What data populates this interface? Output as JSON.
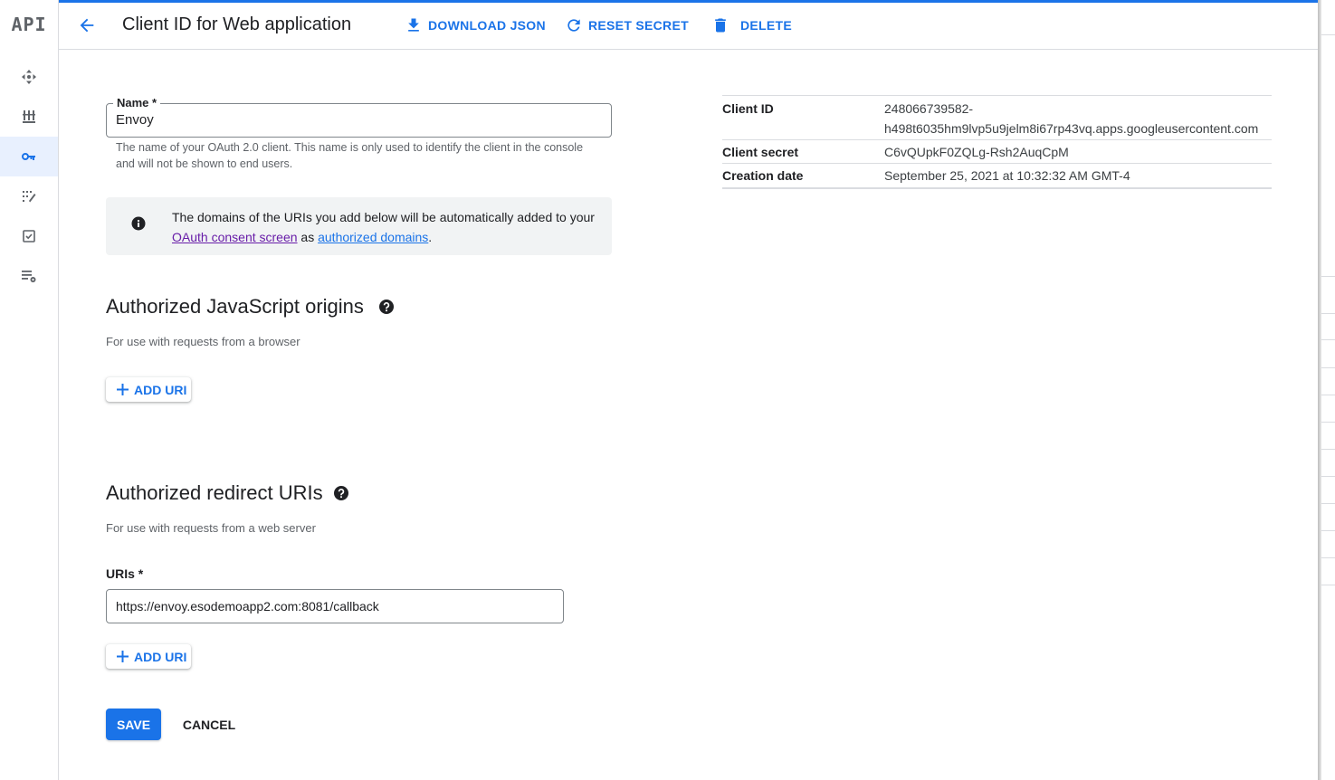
{
  "rail": {
    "logo": "API",
    "items": [
      {
        "icon": "dashboard-icon"
      },
      {
        "icon": "library-icon"
      },
      {
        "icon": "key-icon",
        "active": true
      },
      {
        "icon": "consent-icon"
      },
      {
        "icon": "checkbox-icon"
      },
      {
        "icon": "settings-list-icon"
      }
    ]
  },
  "header": {
    "title": "Client ID for Web application",
    "download_label": "DOWNLOAD JSON",
    "reset_label": "RESET SECRET",
    "delete_label": "DELETE"
  },
  "name_field": {
    "label": "Name *",
    "value": "Envoy",
    "hint": "The name of your OAuth 2.0 client. This name is only used to identify the client in the console and will not be shown to end users."
  },
  "info": {
    "text_before": "The domains of the URIs you add below will be automatically added to your ",
    "consent_link": "OAuth consent screen",
    "text_middle": " as ",
    "domains_link": "authorized domains",
    "text_after": "."
  },
  "js_origins": {
    "title": "Authorized JavaScript origins",
    "subtitle": "For use with requests from a browser",
    "add_label": "ADD URI"
  },
  "redirect_uris": {
    "title": "Authorized redirect URIs",
    "subtitle": "For use with requests from a web server",
    "uris_label": "URIs *",
    "uri_value": "https://envoy.esodemoapp2.com:8081/callback",
    "add_label": "ADD URI"
  },
  "actions": {
    "save_label": "SAVE",
    "cancel_label": "CANCEL"
  },
  "details": {
    "client_id_label": "Client ID",
    "client_id_line1": "248066739582-",
    "client_id_line2": "h498t6035hm9lvp5u9jelm8i67rp43vq.apps.googleusercontent.com",
    "client_secret_label": "Client secret",
    "client_secret_value": "C6vQUpkF0ZQLg-Rsh2AuqCpM",
    "creation_date_label": "Creation date",
    "creation_date_value": "September 25, 2021 at 10:32:32 AM GMT-4"
  },
  "colors": {
    "accent": "#1a73e8",
    "visited_link": "#681da8",
    "info_bg": "#f1f3f4"
  }
}
